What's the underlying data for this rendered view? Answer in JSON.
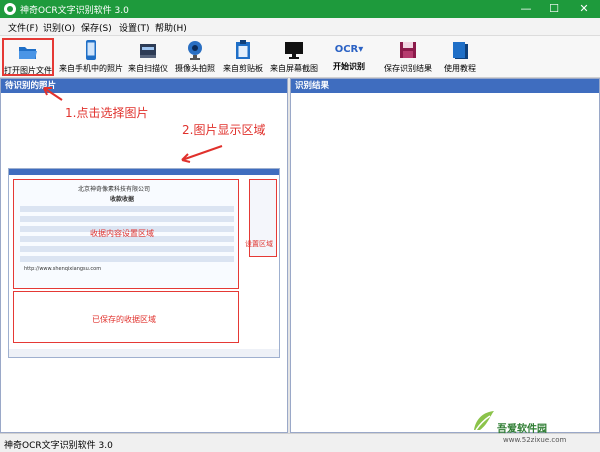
{
  "window": {
    "title": "神奇OCR文字识别软件 3.0",
    "minimize_icon": "minimize-icon",
    "maximize_icon": "maximize-icon",
    "close_icon": "close-icon",
    "accent_color": "#1e9a3c"
  },
  "menu": {
    "items": [
      {
        "label": "文件(F)"
      },
      {
        "label": "识别(O)"
      },
      {
        "label": "保存(S)"
      },
      {
        "label": "设置(T)"
      },
      {
        "label": "帮助(H)"
      }
    ]
  },
  "toolbar": {
    "items": [
      {
        "label": "打开图片文件",
        "icon": "folder-open-icon"
      },
      {
        "label": "来自手机中的照片",
        "icon": "phone-icon"
      },
      {
        "label": "来自扫描仪",
        "icon": "scanner-icon"
      },
      {
        "label": "摄像头拍照",
        "icon": "webcam-icon"
      },
      {
        "label": "来自剪贴板",
        "icon": "clipboard-icon"
      },
      {
        "label": "来自屏幕截图",
        "icon": "monitor-icon"
      },
      {
        "label": "开始识别",
        "icon": "ocr-icon",
        "icon_text": "OCR▾"
      },
      {
        "label": "保存识别结果",
        "icon": "save-icon"
      },
      {
        "label": "使用教程",
        "icon": "book-icon"
      }
    ]
  },
  "left_panel": {
    "title": "待识别的照片"
  },
  "right_panel": {
    "title": "识别结果"
  },
  "annotations": {
    "step1": "1.点击选择图片",
    "step2": "2.图片显示区域",
    "color": "#e0312c"
  },
  "preview": {
    "company": "北京神奇像素科技有限公司",
    "doc_title": "收款收据",
    "content_label": "收据内容设置区域",
    "side_label": "设置区域",
    "list_label": "已保存的收据区域",
    "url_text": "http://www.shenqixiangsu.com"
  },
  "statusbar": {
    "text": "神奇OCR文字识别软件 3.0"
  },
  "watermark": {
    "site_name": "吾爱软件园",
    "url": "www.52zixue.com"
  }
}
